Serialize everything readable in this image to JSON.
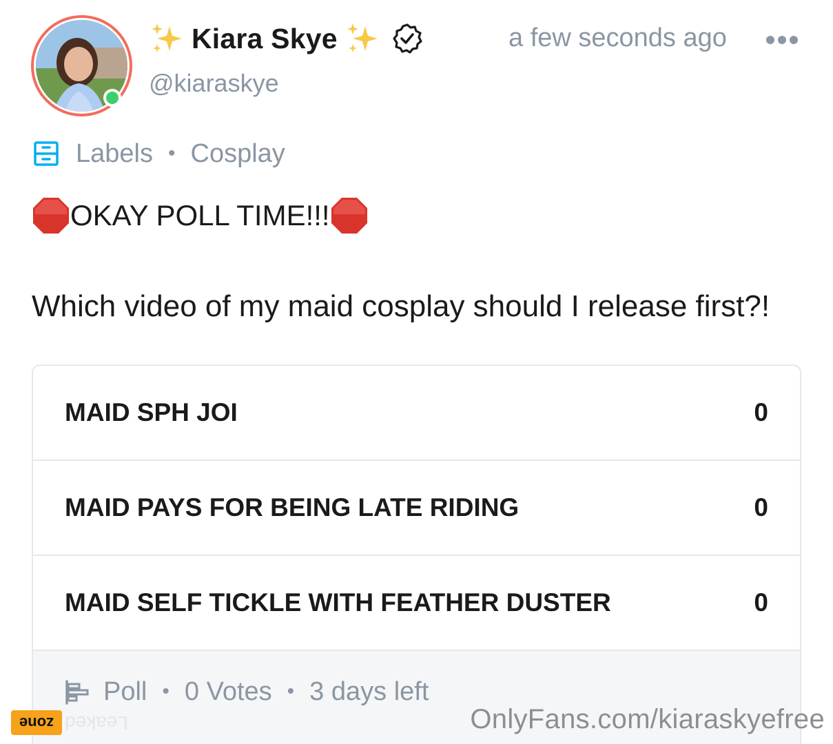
{
  "post": {
    "author_name": "Kiara Skye",
    "username": "@kiaraskye",
    "timestamp": "a few seconds ago",
    "labels_title": "Labels",
    "label": "Cosplay",
    "headline": "OKAY POLL TIME!!!",
    "question": "Which video of my maid cosplay should I release first?!"
  },
  "poll": {
    "options": [
      {
        "label": "MAID SPH JOI",
        "count": "0"
      },
      {
        "label": "MAID PAYS FOR BEING LATE RIDING",
        "count": "0"
      },
      {
        "label": "MAID SELF TICKLE WITH FEATHER DUSTER",
        "count": "0"
      }
    ],
    "type_label": "Poll",
    "votes": "0 Votes",
    "time_left": "3 days left"
  },
  "watermark": {
    "badge": "zone",
    "ghost": "Leaked",
    "url": "OnlyFans.com/kiaraskyefree"
  },
  "icons": {
    "sparkles": "sparkles-icon",
    "verified": "verified-badge-icon",
    "more": "more-dots-icon",
    "labels": "labels-icon",
    "stop_sign": "stop-sign-icon",
    "poll": "poll-icon"
  },
  "colors": {
    "accent_ring": "#f26d5b",
    "online": "#3ccf6a",
    "muted_text": "#8a96a3",
    "link_blue": "#00aff0",
    "stop_red": "#d9342b",
    "watermark_badge": "#f6a21a"
  }
}
